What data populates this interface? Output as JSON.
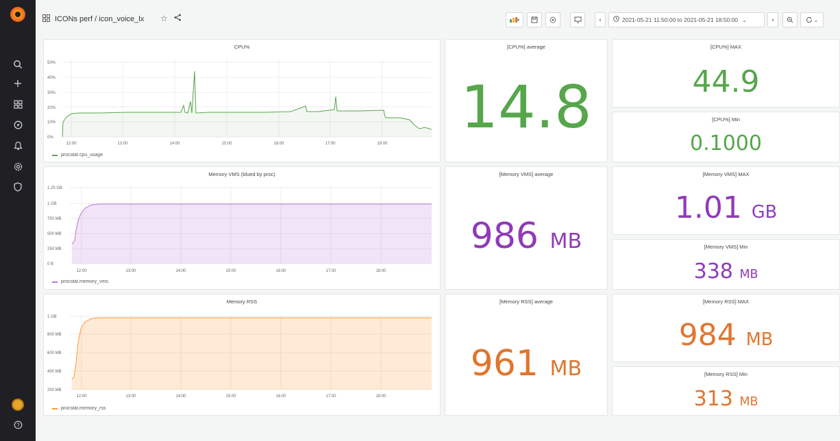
{
  "colors": {
    "green": "#56a64b",
    "purple": "#8f3bb8",
    "orange": "#e0752d",
    "sidebar": "#1f1f24",
    "background": "#f4f5f5"
  },
  "sidebar": {
    "icons": [
      "grafana-logo-icon",
      "search-icon",
      "plus-icon",
      "dashboards-icon",
      "explore-icon",
      "alerting-icon",
      "configuration-icon",
      "server-admin-icon",
      "user-avatar-icon",
      "help-icon"
    ]
  },
  "topbar": {
    "breadcrumb": "ICONs perf / icon_voice_lx",
    "time_range": "2021-05-21 11:50:00 to 2021-05-21 18:50:00"
  },
  "panels": {
    "cpu_chart": {
      "title": "CPU%",
      "legend": "procstat.cpu_usage",
      "y_ticks": [
        "50%",
        "40%",
        "30%",
        "20%",
        "10%",
        "0%"
      ],
      "x_ticks": [
        "12:00",
        "13:00",
        "14:00",
        "15:00",
        "16:00",
        "17:00",
        "18:00"
      ]
    },
    "vms_chart": {
      "title": "Memory VMS (blued by proc)",
      "legend": "procstat.memory_vms",
      "y_ticks": [
        "1.25 GB",
        "1 GB",
        "750 MB",
        "500 MB",
        "250 MB",
        "0 B"
      ],
      "x_ticks": [
        "12:00",
        "13:00",
        "14:00",
        "15:00",
        "16:00",
        "17:00",
        "18:00"
      ]
    },
    "rss_chart": {
      "title": "Memory RSS",
      "legend": "procstat.memory_rss",
      "y_ticks": [
        "1 GB",
        "800 MB",
        "600 MB",
        "400 MB",
        "200 MB"
      ],
      "x_ticks": [
        "12:00",
        "13:00",
        "14:00",
        "15:00",
        "16:00",
        "17:00",
        "18:00"
      ]
    },
    "cpu_avg": {
      "title": "[CPU%] average",
      "value": "14.8",
      "unit": ""
    },
    "cpu_max": {
      "title": "[CPU%] MAX",
      "value": "44.9",
      "unit": ""
    },
    "cpu_min": {
      "title": "[CPU%] Min",
      "value": "0.1000",
      "unit": ""
    },
    "vms_avg": {
      "title": "[Memory VMS] average",
      "value": "986",
      "unit": "MB"
    },
    "vms_max": {
      "title": "[Memory VMS] MAX",
      "value": "1.01",
      "unit": "GB"
    },
    "vms_min": {
      "title": "[Memory VMS] Min",
      "value": "338",
      "unit": "MB"
    },
    "rss_avg": {
      "title": "[Memory RSS] average",
      "value": "961",
      "unit": "MB"
    },
    "rss_max": {
      "title": "[Memory RSS] MAX",
      "value": "984",
      "unit": "MB"
    },
    "rss_min": {
      "title": "[Memory RSS] Min",
      "value": "313",
      "unit": "MB"
    }
  }
}
